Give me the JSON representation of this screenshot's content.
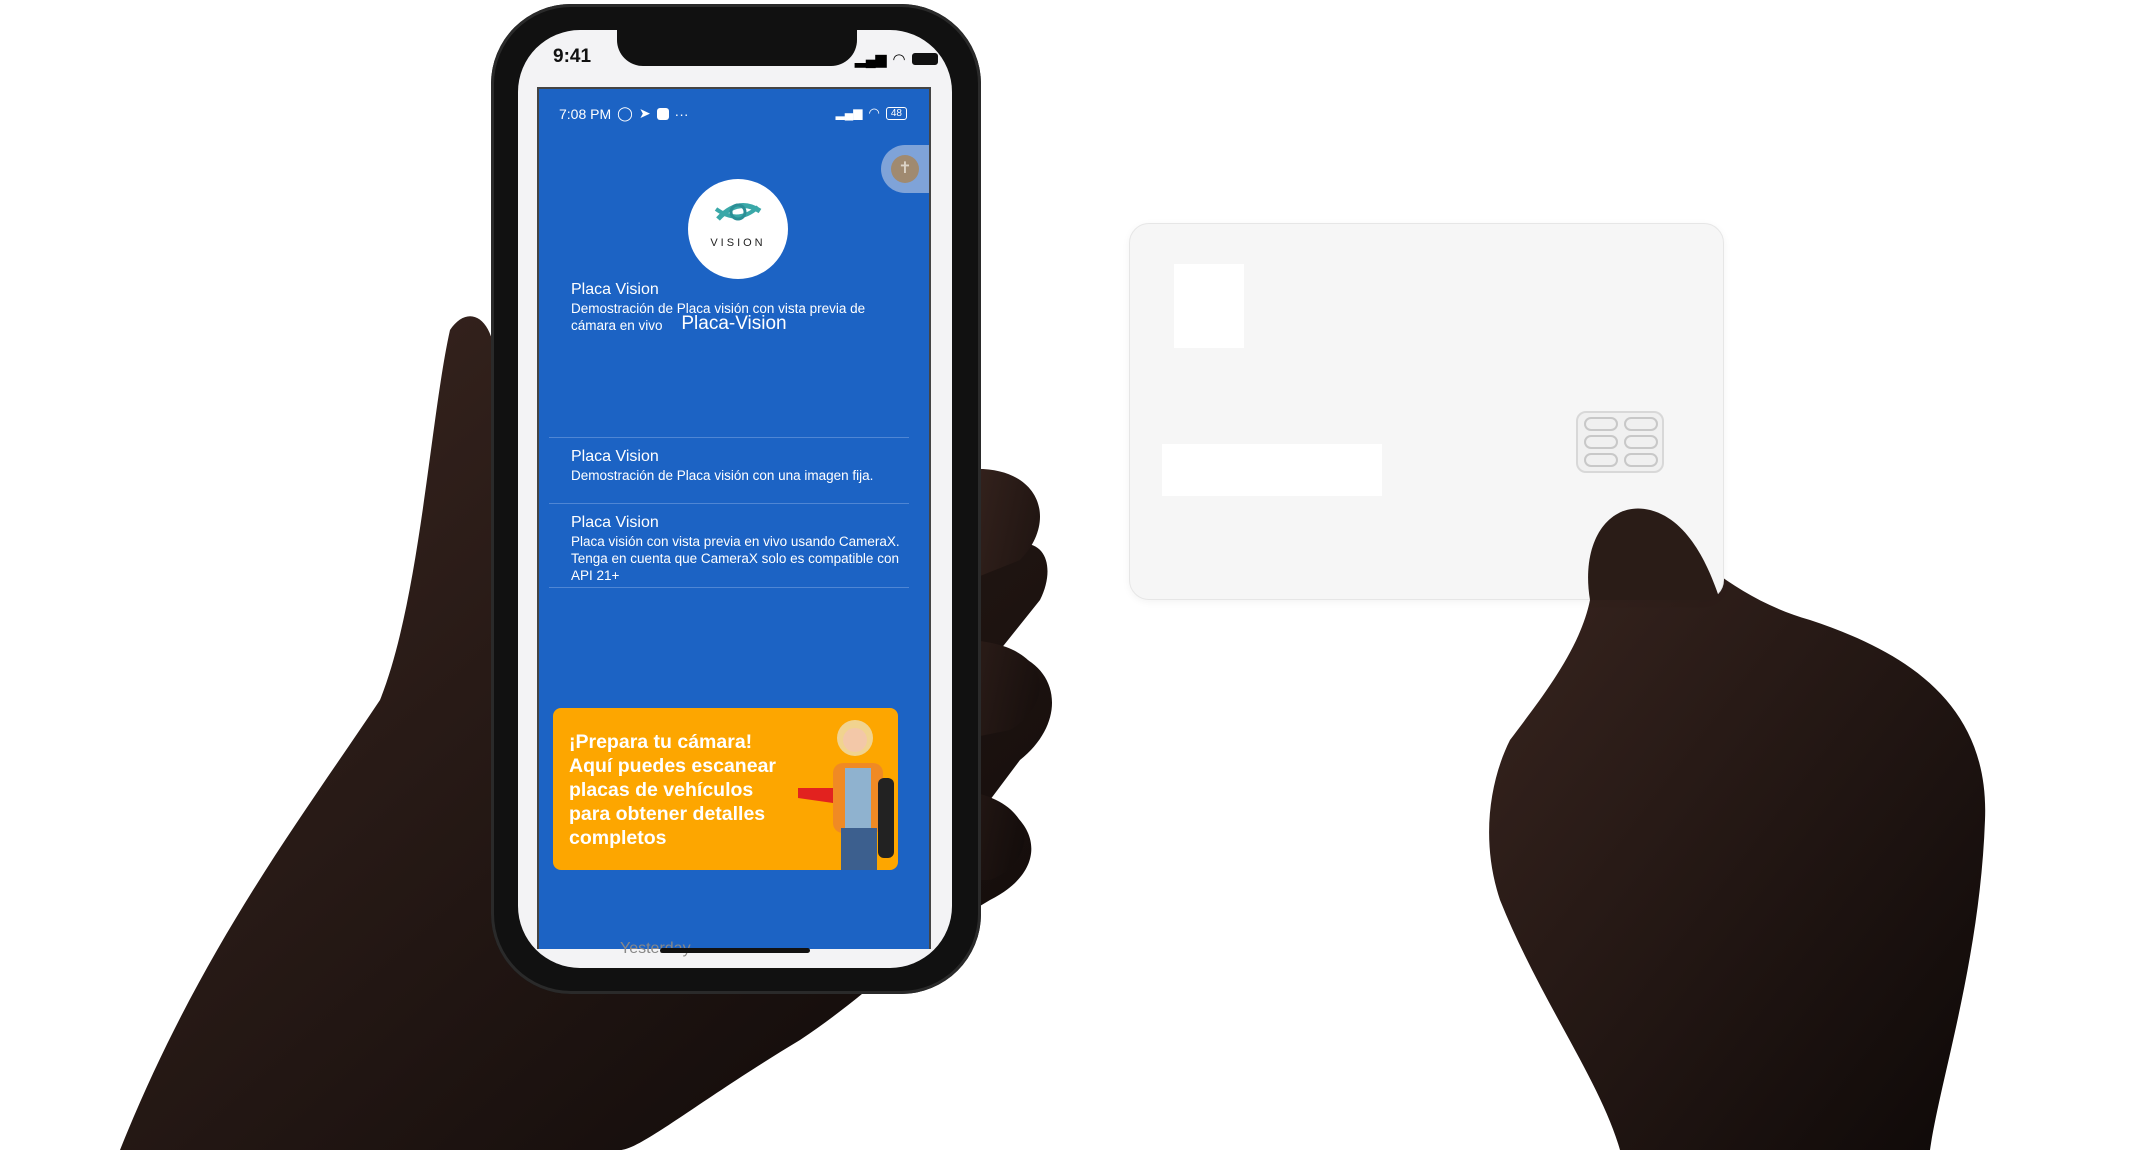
{
  "ios_status": {
    "time": "9:41"
  },
  "android_status": {
    "time": "7:08 PM",
    "battery": "48"
  },
  "app": {
    "logo_text": "VISION",
    "title": "Placa-Vision"
  },
  "menu": [
    {
      "title": "Placa Vision",
      "description": "Demostración de Placa visión con vista previa de cámara en vivo"
    },
    {
      "title": "Placa Vision",
      "description": "Demostración de Placa visión con una imagen fija."
    },
    {
      "title": "Placa Vision",
      "description": "Placa visión con vista previa en vivo usando CameraX. Tenga en cuenta que CameraX solo es compatible con API 21+"
    }
  ],
  "banner": {
    "text": "¡Prepara tu cámara! Aquí puedes escanear placas de vehículos para obtener detalles completos"
  },
  "background_text": "Yesterday",
  "colors": {
    "screen": "#1c63c4",
    "banner": "#fda600"
  }
}
